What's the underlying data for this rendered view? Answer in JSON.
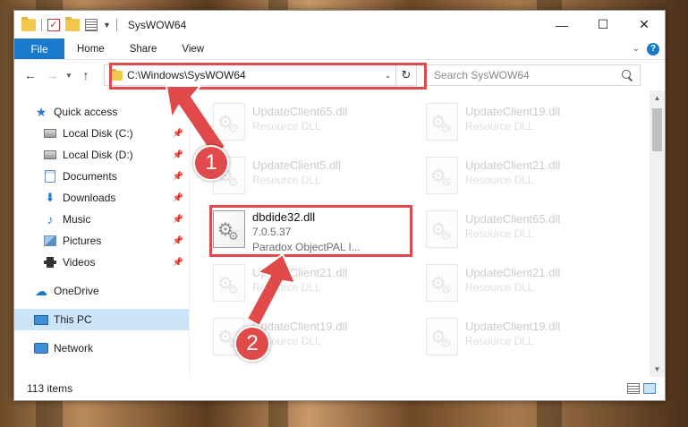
{
  "window": {
    "title": "SysWOW64",
    "controls": {
      "minimize": "—",
      "maximize": "☐",
      "close": "✕"
    }
  },
  "ribbon": {
    "tabs": [
      "File",
      "Home",
      "Share",
      "View"
    ],
    "help": "?"
  },
  "navbar": {
    "back": "←",
    "forward": "→",
    "up": "↑",
    "address": "C:\\Windows\\SysWOW64",
    "search_placeholder": "Search SysWOW64"
  },
  "sidebar": {
    "items": [
      {
        "label": "Quick access",
        "icon": "star-icon"
      },
      {
        "label": "Local Disk (C:)",
        "icon": "disk-icon",
        "pinned": true
      },
      {
        "label": "Local Disk (D:)",
        "icon": "disk-icon",
        "pinned": true
      },
      {
        "label": "Documents",
        "icon": "documents-icon",
        "pinned": true
      },
      {
        "label": "Downloads",
        "icon": "downloads-icon",
        "pinned": true
      },
      {
        "label": "Music",
        "icon": "music-icon",
        "pinned": true
      },
      {
        "label": "Pictures",
        "icon": "pictures-icon",
        "pinned": true
      },
      {
        "label": "Videos",
        "icon": "videos-icon",
        "pinned": true
      },
      {
        "label": "OneDrive",
        "icon": "cloud-icon"
      },
      {
        "label": "This PC",
        "icon": "computer-icon",
        "selected": true
      },
      {
        "label": "Network",
        "icon": "network-icon"
      }
    ]
  },
  "files": [
    {
      "name": "UpdateClient65.dll",
      "sub1": "Resource DLL",
      "sub2": ""
    },
    {
      "name": "UpdateClient19.dll",
      "sub1": "Resource DLL",
      "sub2": ""
    },
    {
      "name": "UpdateClient5.dll",
      "sub1": "Resource DLL",
      "sub2": ""
    },
    {
      "name": "UpdateClient21.dll",
      "sub1": "Resource DLL",
      "sub2": ""
    },
    {
      "name": "dbdide32.dll",
      "sub1": "7.0.5.37",
      "sub2": "Paradox ObjectPAL I..."
    },
    {
      "name": "UpdateClient65.dll",
      "sub1": "Resource DLL",
      "sub2": ""
    },
    {
      "name": "UpdateClient21.dll",
      "sub1": "Resource DLL",
      "sub2": ""
    },
    {
      "name": "UpdateClient21.dll",
      "sub1": "Resource DLL",
      "sub2": ""
    },
    {
      "name": "UpdateClient19.dll",
      "sub1": "Resource DLL",
      "sub2": ""
    },
    {
      "name": "UpdateClient19.dll",
      "sub1": "Resource DLL",
      "sub2": ""
    }
  ],
  "status": {
    "count": "113 items"
  },
  "callouts": {
    "step1": "1",
    "step2": "2"
  },
  "colors": {
    "accent": "#1979ca",
    "highlight": "#e04a4a",
    "selected": "#cce4f7"
  }
}
